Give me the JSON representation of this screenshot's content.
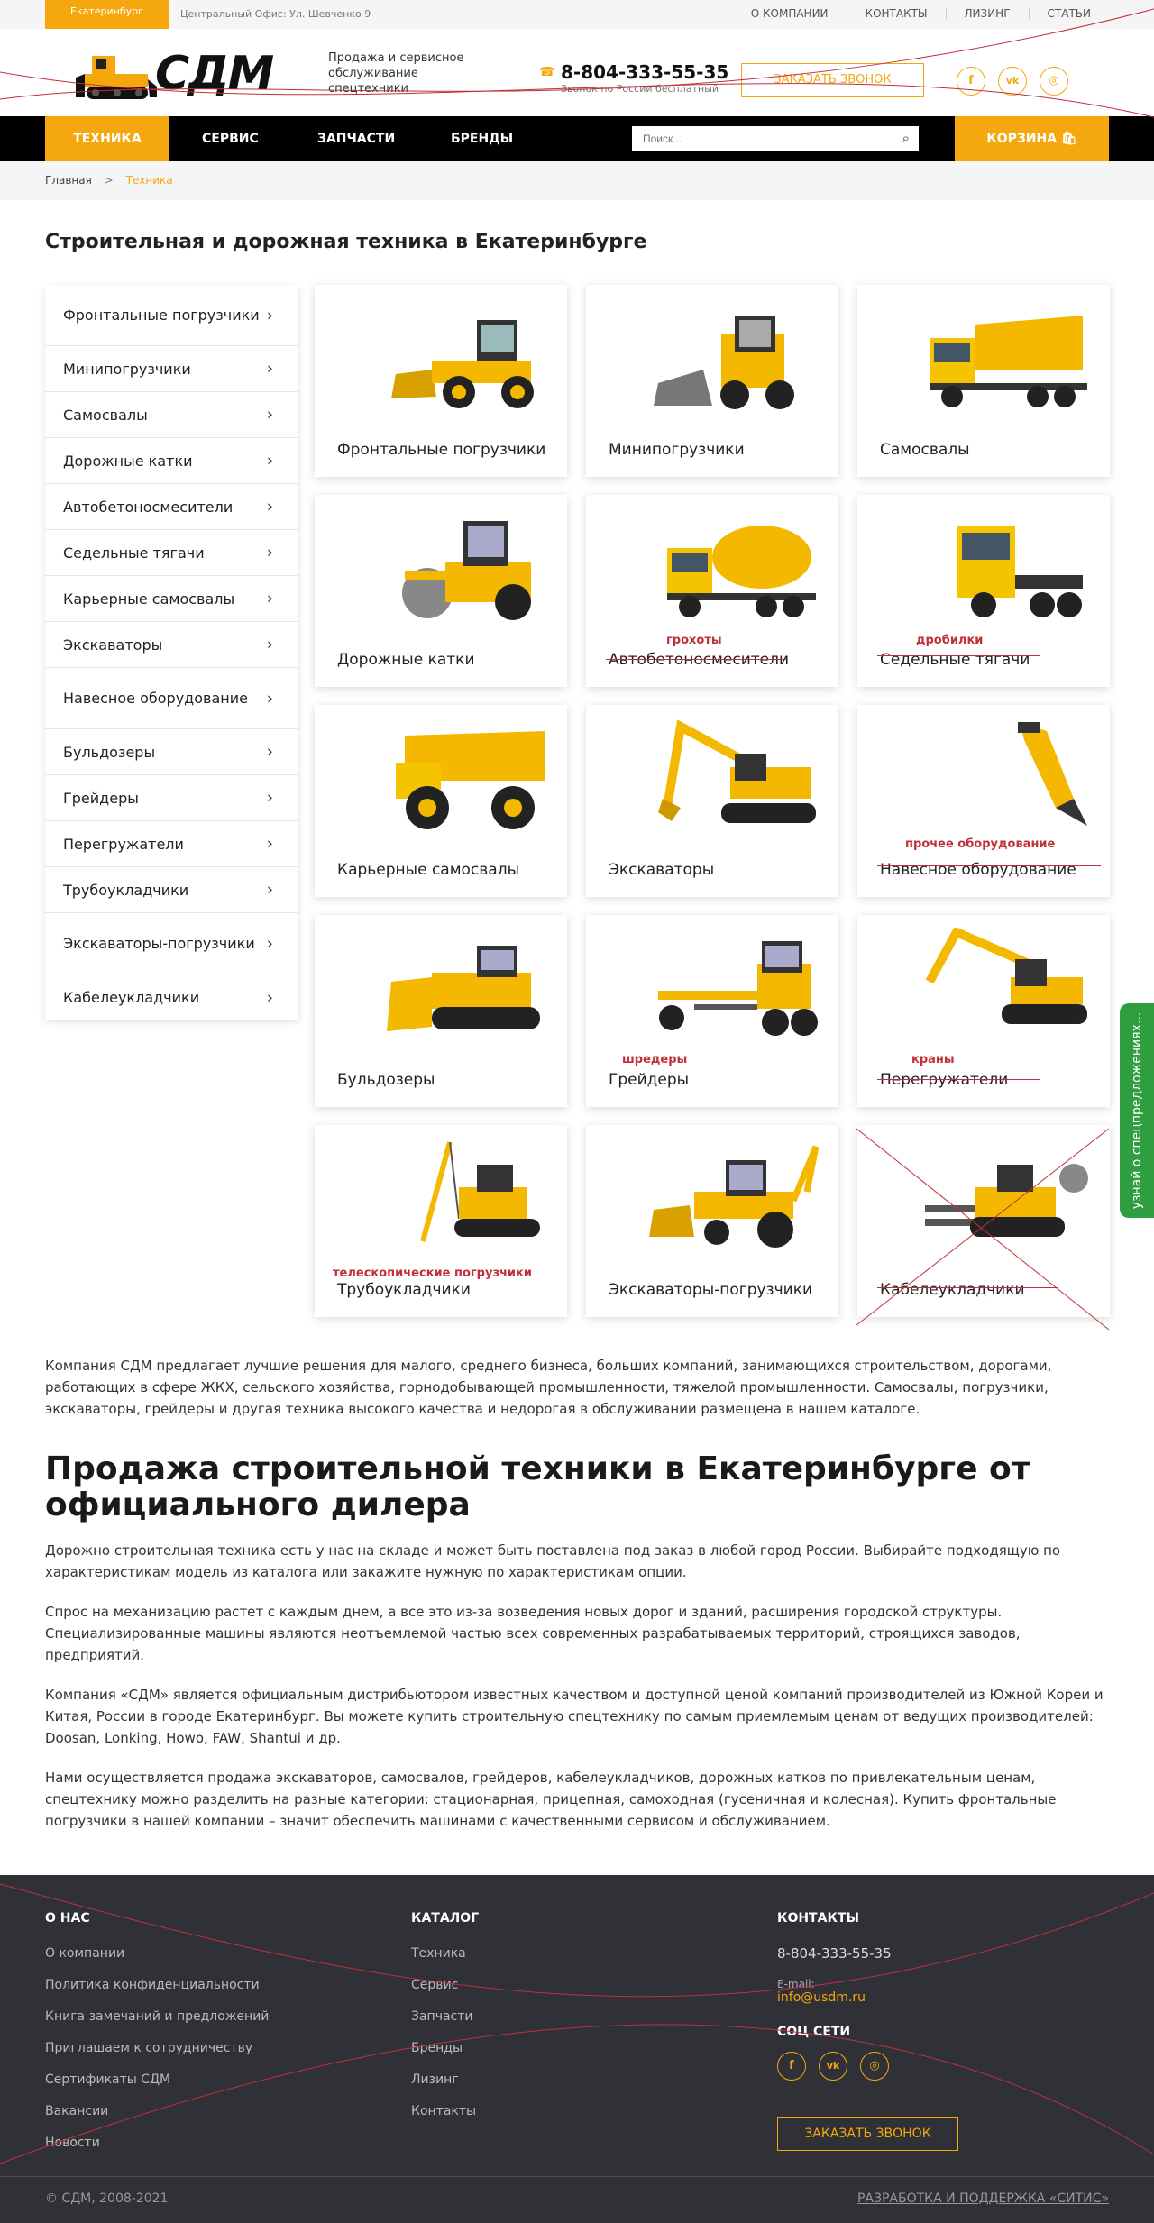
{
  "topbar": {
    "city": "Екатеринбург",
    "office": "Центральный Офис: Ул. Шевченко 9",
    "links": [
      "О КОМПАНИИ",
      "КОНТАКТЫ",
      "ЛИЗИНГ",
      "СТАТЬИ"
    ]
  },
  "header": {
    "logo_text": "СДМ",
    "tagline": "Продажа и сервисное обслуживание спецтехники",
    "phone": "8-804-333-55-35",
    "phone_sub": "Звонок по России бесплатный",
    "callback": "ЗАКАЗАТЬ ЗВОНОК",
    "socials": [
      "f",
      "vk",
      "ig"
    ]
  },
  "nav": {
    "items": [
      "ТЕХНИКА",
      "СЕРВИС",
      "ЗАПЧАСТИ",
      "БРЕНДЫ"
    ],
    "search_placeholder": "Поиск...",
    "cart": "КОРЗИНА"
  },
  "breadcrumb": {
    "home": "Главная",
    "sep": ">",
    "current": "Техника"
  },
  "page_title": "Строительная и дорожная техника в Екатеринбурге",
  "sidebar": [
    "Фронтальные погрузчики",
    "Минипогрузчики",
    "Самосвалы",
    "Дорожные катки",
    "Автобетоносмесители",
    "Седельные тягачи",
    "Карьерные самосвалы",
    "Экскаваторы",
    "Навесное оборудование",
    "Бульдозеры",
    "Грейдеры",
    "Перегружатели",
    "Трубоукладчики",
    "Экскаваторы-погрузчики",
    "Кабелеукладчики"
  ],
  "cards": [
    {
      "label": "Фронтальные погрузчики",
      "note": ""
    },
    {
      "label": "Минипогрузчики",
      "note": ""
    },
    {
      "label": "Самосвалы",
      "note": ""
    },
    {
      "label": "Дорожные катки",
      "note": ""
    },
    {
      "label": "Автобетоносмесители",
      "note": "грохоты"
    },
    {
      "label": "Седельные тягачи",
      "note": "дробилки"
    },
    {
      "label": "Карьерные самосвалы",
      "note": ""
    },
    {
      "label": "Экскаваторы",
      "note": ""
    },
    {
      "label": "Навесное оборудование",
      "note": "прочее оборудование"
    },
    {
      "label": "Бульдозеры",
      "note": ""
    },
    {
      "label": "Грейдеры",
      "note": "шредеры"
    },
    {
      "label": "Перегружатели",
      "note": "краны"
    },
    {
      "label": "Трубоукладчики",
      "note": "телескопические погрузчики"
    },
    {
      "label": "Экскаваторы-погрузчики",
      "note": ""
    },
    {
      "label": "Кабелеукладчики",
      "note": ""
    }
  ],
  "intro": "Компания СДМ предлагает лучшие решения для малого, среднего бизнеса, больших компаний, занимающихся строительством, дорогами, работающих в сфере ЖКХ, сельского хозяйства, горнодобывающей промышленности, тяжелой промышленности. Самосвалы, погрузчики, экскаваторы, грейдеры и другая техника высокого качества и недорогая в обслуживании размещена в нашем каталоге.",
  "sale_title": "Продажа строительной техники в Екатеринбурге от официального дилера",
  "paragraphs": [
    "Дорожно строительная техника есть у нас на складе и может быть поставлена под заказ в любой город России. Выбирайте подходящую по характеристикам модель из каталога или закажите нужную по характеристикам опции.",
    "Спрос на механизацию растет с каждым днем, а все это из-за возведения новых дорог и зданий, расширения городской структуры. Специализированные машины являются неотъемлемой частью всех современных разрабатываемых территорий, строящихся заводов, предприятий.",
    "Компания «СДМ» является официальным дистрибьютором известных качеством и доступной ценой компаний производителей из Южной Кореи и Китая, России в городе Екатеринбург. Вы можете купить строительную спецтехнику по самым приемлемым ценам от ведущих производителей: Doosan, Lonking, Howo, FAW, Shantui и др.",
    "Нами осуществляется продажа экскаваторов, самосвалов, грейдеров, кабелеукладчиков, дорожных катков по привлекательным ценам, спецтехнику можно разделить на разные категории: стационарная, прицепная, самоходная (гусеничная и колесная). Купить фронтальные погрузчики в нашей компании – значит обеспечить машинами с качественными сервисом и обслуживанием."
  ],
  "footer": {
    "about_title": "О НАС",
    "about_links": [
      "О компании",
      "Политика конфиденциальности",
      "Книга замечаний и предложений",
      "Приглашаем к сотрудничеству",
      "Сертификаты СДМ",
      "Вакансии",
      "Новости"
    ],
    "catalog_title": "КАТАЛОГ",
    "catalog_links": [
      "Техника",
      "Сервис",
      "Запчасти",
      "Бренды",
      "Лизинг",
      "Контакты"
    ],
    "contacts_title": "КОНТАКТЫ",
    "phone": "8-804-333-55-35",
    "email_label": "E-mail:",
    "email": "info@usdm.ru",
    "social_title": "СОЦ СЕТИ",
    "callback": "ЗАКАЗАТЬ ЗВОНОК",
    "copyright": "© СДМ, 2008-2021",
    "developer": "РАЗРАБОТКА И ПОДДЕРЖКА «СИТИС»"
  },
  "side_tab": "узнай о спецпредложениях..."
}
